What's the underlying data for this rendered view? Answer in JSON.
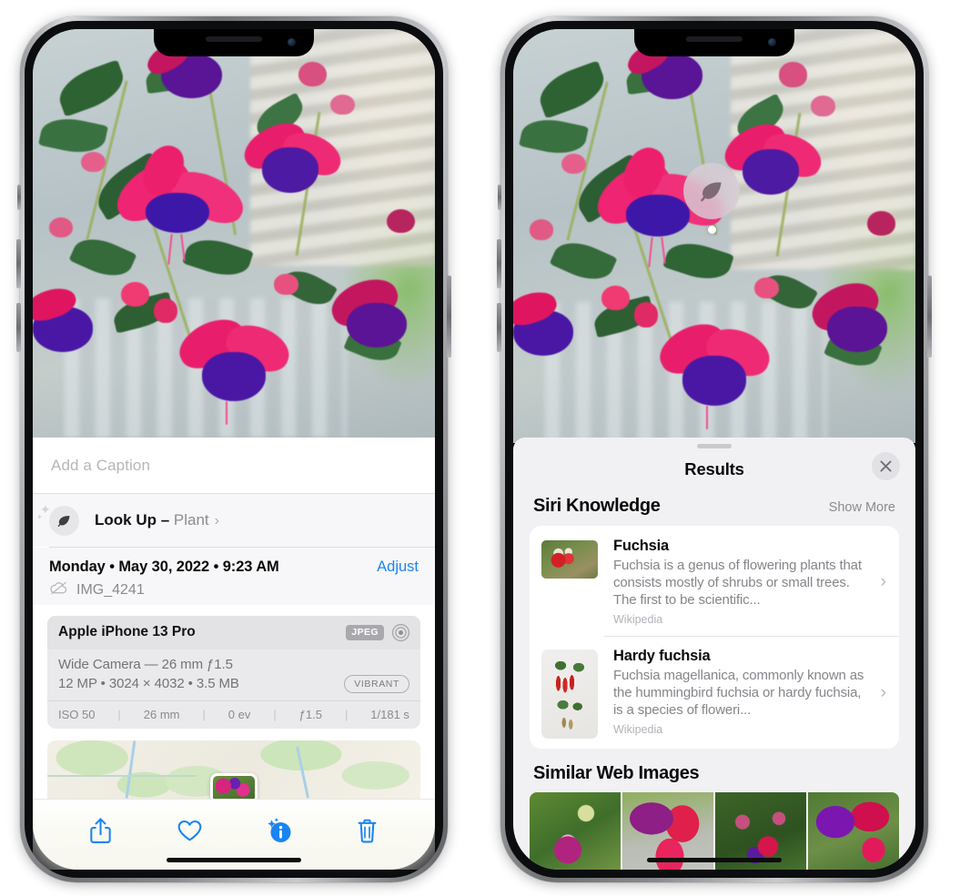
{
  "left_phone": {
    "caption": {
      "placeholder": "Add a Caption",
      "value": ""
    },
    "lookup": {
      "label": "Look Up",
      "dash": " – ",
      "kind": "Plant",
      "chevron": "›",
      "icon": "leaf-icon"
    },
    "metadata": {
      "date_line": "Monday • May 30, 2022 • 9:23 AM",
      "adjust_label": "Adjust",
      "filename": "IMG_4241",
      "cloud_icon": "icloud-slash-icon"
    },
    "camera_card": {
      "model": "Apple iPhone 13 Pro",
      "format_badge": "JPEG",
      "lens_icon": "aperture-icon",
      "lens_line": "Wide Camera — 26 mm ƒ1.5",
      "specs_line": "12 MP • 3024 × 4032 • 3.5 MB",
      "style_badge": "VIBRANT",
      "exif": [
        "ISO 50",
        "26 mm",
        "0 ev",
        "ƒ1.5",
        "1/181 s"
      ]
    },
    "toolbar": [
      {
        "name": "share-button",
        "icon": "share-icon"
      },
      {
        "name": "favorite-button",
        "icon": "heart-icon"
      },
      {
        "name": "info-button",
        "icon": "info-sparkle-icon"
      },
      {
        "name": "delete-button",
        "icon": "trash-icon"
      }
    ],
    "accent_color": "#1b84f3"
  },
  "right_phone": {
    "visual_lookup_badge": {
      "icon": "leaf-icon"
    },
    "sheet": {
      "title": "Results",
      "close_icon": "close-icon",
      "sections": [
        {
          "title": "Siri Knowledge",
          "action_label": "Show More",
          "cards": [
            {
              "title": "Fuchsia",
              "description": "Fuchsia is a genus of flowering plants that consists mostly of shrubs or small trees. The first to be scientific...",
              "source": "Wikipedia",
              "chevron": "›"
            },
            {
              "title": "Hardy fuchsia",
              "description": "Fuchsia magellanica, commonly known as the hummingbird fuchsia or hardy fuchsia, is a species of floweri...",
              "source": "Wikipedia",
              "chevron": "›"
            }
          ]
        },
        {
          "title": "Similar Web Images",
          "images": [
            "web-image-1",
            "web-image-2",
            "web-image-3",
            "web-image-4"
          ]
        }
      ]
    }
  }
}
